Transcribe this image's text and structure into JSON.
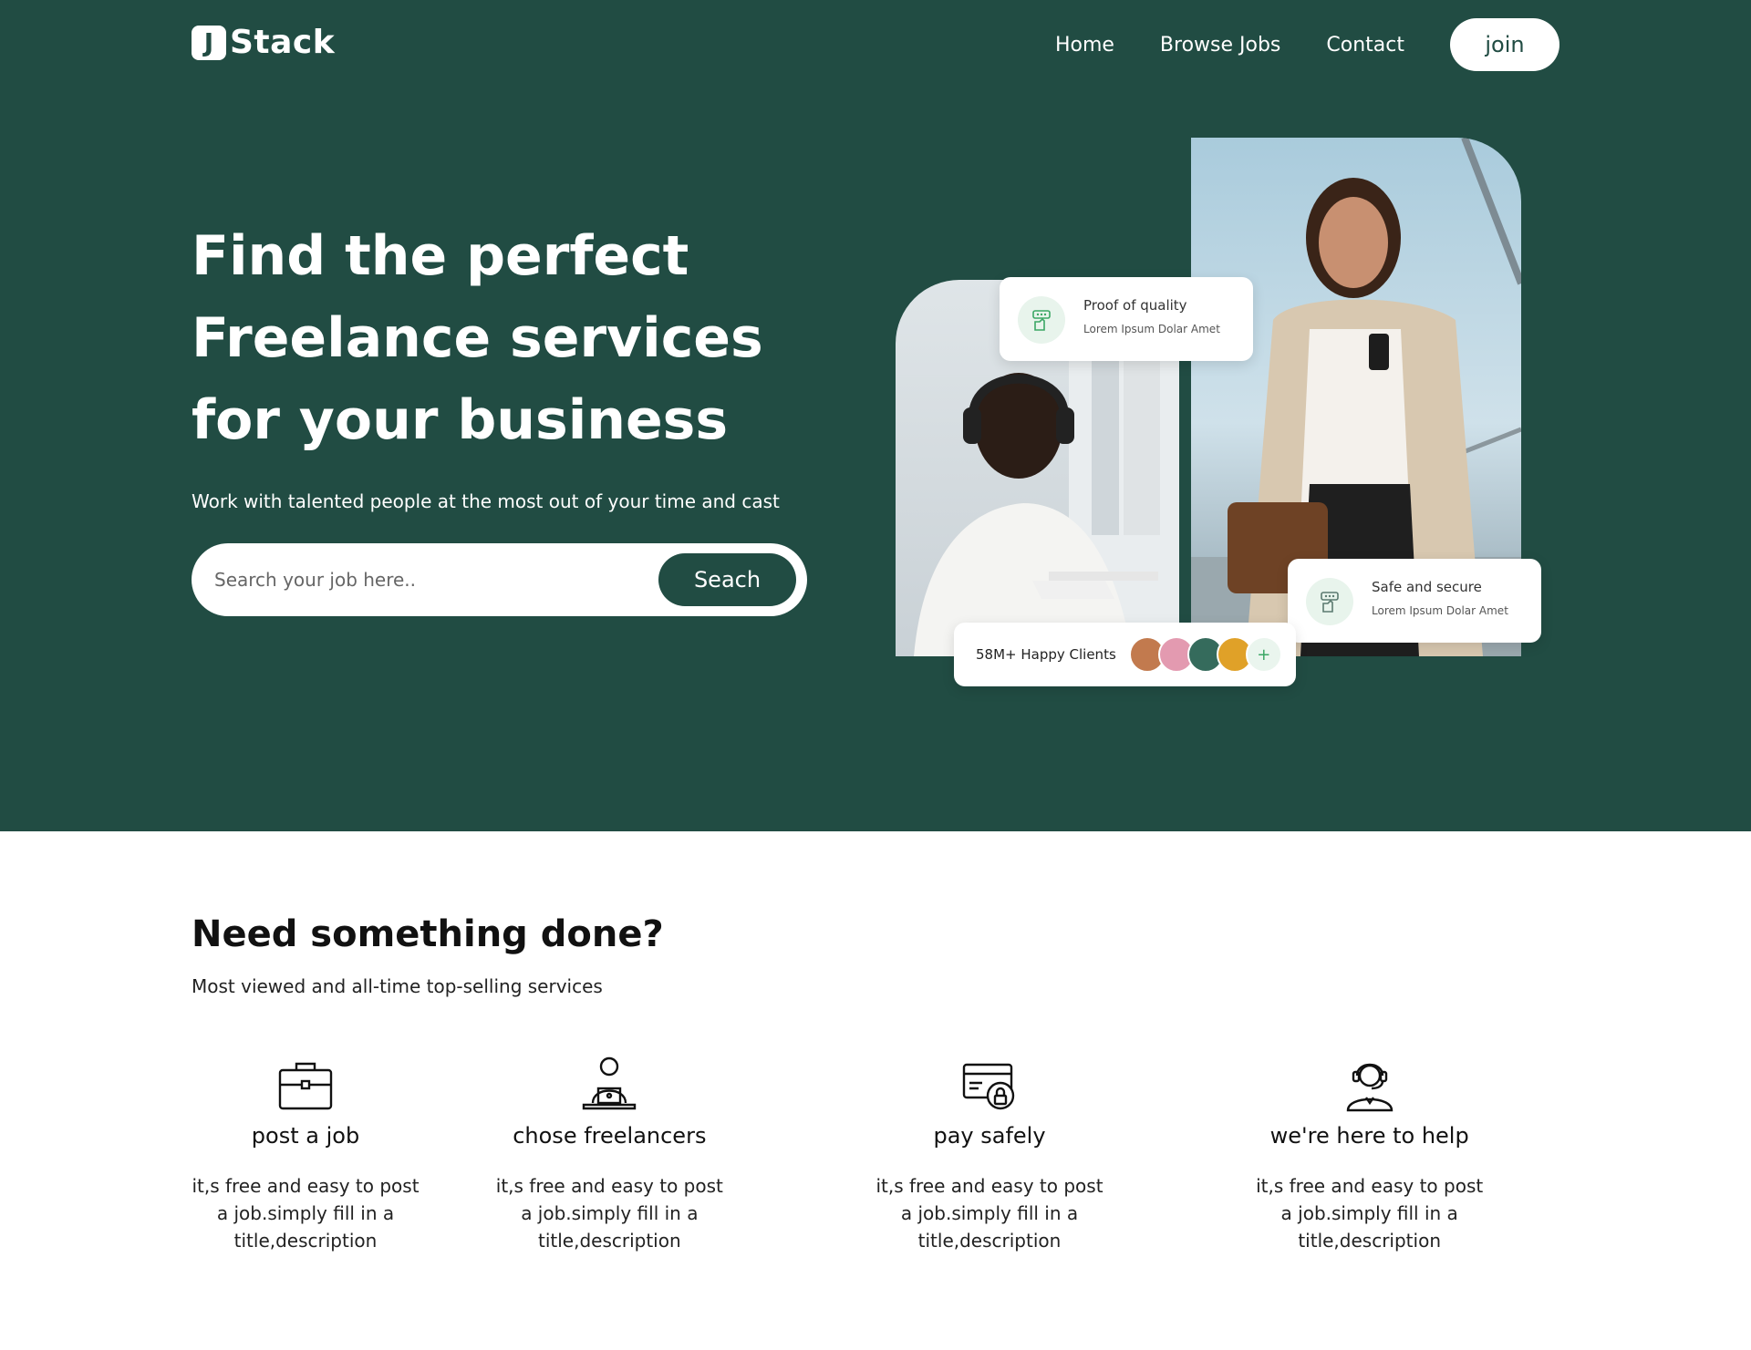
{
  "brand": {
    "logo_letter": "J",
    "name": "Stack"
  },
  "nav": {
    "items": [
      "Home",
      "Browse Jobs",
      "Contact"
    ],
    "join_label": "join"
  },
  "hero": {
    "title": "Find the perfect Freelance services for your business",
    "subtitle": "Work with talented people at the most out of your time and cast",
    "search_placeholder": "Search your job here..",
    "search_button": "Seach"
  },
  "cards": {
    "quality": {
      "title": "Proof of quality",
      "text": "Lorem Ipsum Dolar Amet"
    },
    "safe": {
      "title": "Safe and secure",
      "text": "Lorem Ipsum Dolar Amet"
    },
    "clients": {
      "label": "58M+ Happy Clients",
      "plus": "+"
    }
  },
  "services": {
    "title": "Need something done?",
    "subtitle": "Most viewed and all-time top-selling services",
    "items": [
      {
        "icon": "briefcase-icon",
        "name": "post a job",
        "desc": "it,s free and easy to post a job.simply fill in a title,description"
      },
      {
        "icon": "laptop-user-icon",
        "name": "chose freelancers",
        "desc": "it,s free and easy to post a job.simply fill in a title,description"
      },
      {
        "icon": "secure-card-icon",
        "name": "pay safely",
        "desc": "it,s free and easy to post a job.simply fill in a title,description"
      },
      {
        "icon": "headset-support-icon",
        "name": "we're here to help",
        "desc": "it,s free and easy to post a job.simply fill in a title,description"
      }
    ]
  },
  "colors": {
    "primary": "#214c43",
    "accent_green": "#3ba765",
    "white": "#ffffff"
  }
}
